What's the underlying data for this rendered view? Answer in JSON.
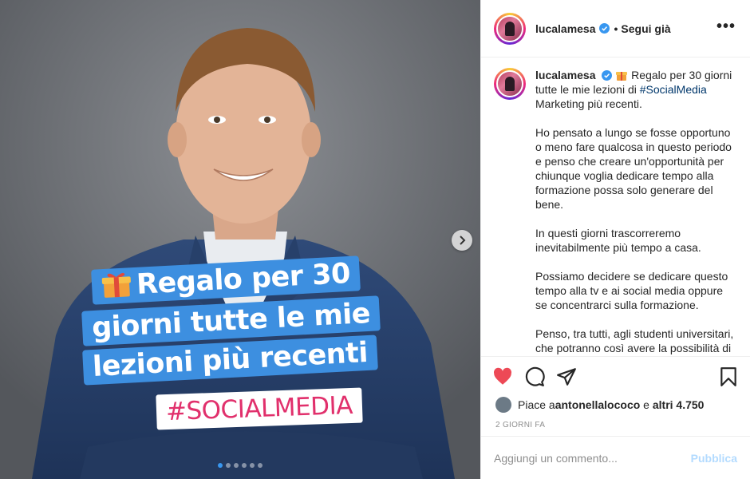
{
  "post": {
    "overlay": {
      "line1": "Regalo per 30",
      "line2": "giorni tutte le mie",
      "line3": "lezioni più recenti",
      "hashtag": "#SOCIALMEDIA"
    },
    "carousel": {
      "slide_count": 6,
      "current": 1
    }
  },
  "header": {
    "username": "lucalamesa",
    "separator": "•",
    "follow_label": "Segui già",
    "more_label": "•••"
  },
  "caption": {
    "username": "lucalamesa",
    "line_intro": " Regalo per 30 giorni tutte le mie lezioni di ",
    "hashtag": "#SocialMedia",
    "line_intro_end": " Marketing più recenti.",
    "p1": "Ho pensato a lungo se fosse opportuno o meno fare qualcosa in questo periodo e penso che creare un'opportunità per chiunque voglia dedicare tempo alla formazione possa solo generare del bene.",
    "p2": "In questi giorni trascorreremo inevitabilmente più tempo a casa.",
    "p3": "Possiamo decidere se dedicare questo tempo alla tv e ai social media oppure se concentrarci sulla formazione.",
    "p4": "Penso, tra tutti, agli studenti universitari, che potranno così avere la possibilità di integrare ciò che imparano in classe con"
  },
  "likes": {
    "prefix": "Piace a ",
    "user": "antonellalococo",
    "middle": " e ",
    "others": "altri 4.750"
  },
  "date": "2 GIORNI FA",
  "comment": {
    "placeholder": "Aggiungi un commento...",
    "publish_label": "Pubblica"
  },
  "colors": {
    "banner_blue": "#3d8fe0",
    "like_red": "#ed4956",
    "hashtag_link": "#00376b",
    "publish_disabled": "#b3dbff",
    "verified_blue": "#3897f0"
  }
}
